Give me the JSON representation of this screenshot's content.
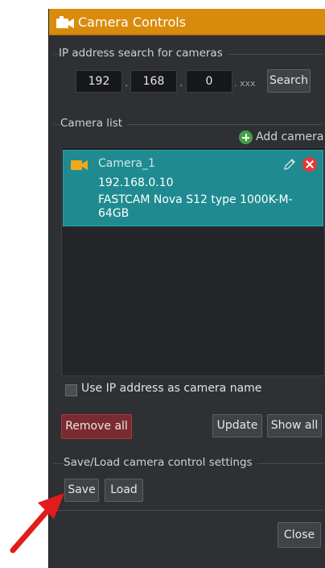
{
  "window": {
    "title": "Camera Controls",
    "accent_color": "#d98b0c"
  },
  "ip_search": {
    "group_label": "IP address search for cameras",
    "octet1": "192",
    "octet2": "168",
    "octet3": "0",
    "suffix": ". xxx",
    "dot": ".",
    "search_label": "Search"
  },
  "camera_list": {
    "group_label": "Camera list",
    "add_camera_label": "Add camera",
    "items": [
      {
        "name": "Camera_1",
        "ip": "192.168.0.10",
        "model": "FASTCAM Nova S12 type 1000K-M-64GB"
      }
    ],
    "use_ip_checkbox_label": "Use IP address as camera name",
    "use_ip_checked": false,
    "remove_all_label": "Remove all",
    "update_label": "Update",
    "show_all_label": "Show all"
  },
  "settings": {
    "group_label": "Save/Load camera control settings",
    "save_label": "Save",
    "load_label": "Load"
  },
  "footer": {
    "close_label": "Close"
  },
  "icons": {
    "title": "camera-icon",
    "add": "plus-circle-icon",
    "camera_item": "camera-icon",
    "edit": "pencil-icon",
    "delete": "close-icon",
    "annotation": "red-arrow-icon"
  }
}
